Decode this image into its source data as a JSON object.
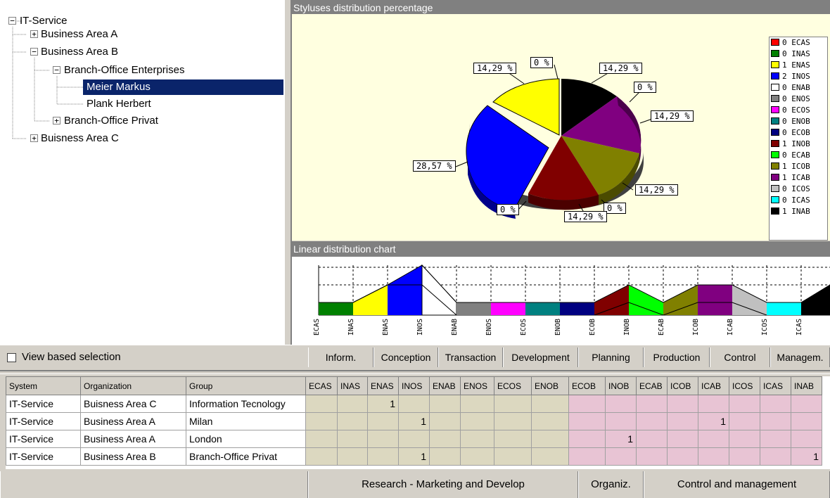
{
  "tree": {
    "root": "IT-Service",
    "area_a": "Business Area A",
    "area_b": "Business Area B",
    "branch_ent": "Branch-Office Enterprises",
    "meier": "Meier Markus",
    "plank": "Plank Herbert",
    "branch_priv": "Branch-Office Privat",
    "area_c": "Buisness Area C"
  },
  "pie": {
    "title": "Styluses distribution percentage",
    "labels": {
      "l1": "14,29 %",
      "l2": "0 %",
      "l3": "14,29 %",
      "l4": "0 %",
      "l5": "14,29 %",
      "l6": "28,57 %",
      "l7": "14,29 %",
      "l8": "0 %",
      "l9": "0 %",
      "l10": "14,29 %"
    },
    "legend": [
      {
        "label": "0 ECAS",
        "color": "#ff0000"
      },
      {
        "label": "0 INAS",
        "color": "#008000"
      },
      {
        "label": "1 ENAS",
        "color": "#ffff00"
      },
      {
        "label": "2 INOS",
        "color": "#0000ff"
      },
      {
        "label": "0 ENAB",
        "color": "#ffffff"
      },
      {
        "label": "0 ENOS",
        "color": "#808080"
      },
      {
        "label": "0 ECOS",
        "color": "#ff00ff"
      },
      {
        "label": "0 ENOB",
        "color": "#008080"
      },
      {
        "label": "0 ECOB",
        "color": "#000080"
      },
      {
        "label": "1 INOB",
        "color": "#800000"
      },
      {
        "label": "0 ECAB",
        "color": "#00ff00"
      },
      {
        "label": "1 ICOB",
        "color": "#808000"
      },
      {
        "label": "1 ICAB",
        "color": "#800080"
      },
      {
        "label": "0 ICOS",
        "color": "#c0c0c0"
      },
      {
        "label": "0 ICAS",
        "color": "#00ffff"
      },
      {
        "label": "1 INAB",
        "color": "#000000"
      }
    ]
  },
  "chart_data": {
    "type": "pie",
    "title": "Styluses distribution percentage",
    "categories": [
      "ECAS",
      "INAS",
      "ENAS",
      "INOS",
      "ENAB",
      "ENOS",
      "ECOS",
      "ENOB",
      "ECOB",
      "INOB",
      "ECAB",
      "ICOB",
      "ICAB",
      "ICOS",
      "ICAS",
      "INAB"
    ],
    "values": [
      0,
      0,
      1,
      2,
      0,
      0,
      0,
      0,
      0,
      1,
      0,
      1,
      1,
      0,
      0,
      1
    ],
    "percent_labels": [
      "14,29 %",
      "28,57 %",
      "14,29 %",
      "14,29 %",
      "14,29 %",
      "14,29 %"
    ],
    "legend_position": "right"
  },
  "linear": {
    "title": "Linear distribution chart",
    "ticks": [
      "ECAS",
      "INAS",
      "ENAS",
      "INOS",
      "ENAB",
      "ENOS",
      "ECOS",
      "ENOB",
      "ECOB",
      "INOB",
      "ECAB",
      "ICOB",
      "ICAB",
      "ICOS",
      "ICAS"
    ]
  },
  "categories": {
    "view_based": "View based selection",
    "inform": "Inform.",
    "conception": "Conception",
    "transaction": "Transaction",
    "development": "Development",
    "planning": "Planning",
    "production": "Production",
    "control": "Control",
    "managem": "Managem."
  },
  "grid": {
    "headers": [
      "System",
      "Organization",
      "Group",
      "ECAS",
      "INAS",
      "ENAS",
      "INOS",
      "ENAB",
      "ENOS",
      "ECOS",
      "ENOB",
      "ECOB",
      "INOB",
      "ECAB",
      "ICOB",
      "ICAB",
      "ICOS",
      "ICAS",
      "INAB"
    ],
    "rows": [
      [
        "IT-Service",
        "Buisness Area C",
        "Information Tecnology",
        "",
        "",
        "1",
        "",
        "",
        "",
        "",
        "",
        "",
        "",
        "",
        "",
        "",
        "",
        "",
        ""
      ],
      [
        "IT-Service",
        "Business Area A",
        "Milan",
        "",
        "",
        "",
        "1",
        "",
        "",
        "",
        "",
        "",
        "",
        "",
        "",
        "1",
        "",
        "",
        ""
      ],
      [
        "IT-Service",
        "Business Area A",
        "London",
        "",
        "",
        "",
        "",
        "",
        "",
        "",
        "",
        "",
        "1",
        "",
        "",
        "",
        "",
        "",
        ""
      ],
      [
        "IT-Service",
        "Business Area B",
        "Branch-Office Privat",
        "",
        "",
        "",
        "1",
        "",
        "",
        "",
        "",
        "",
        "",
        "",
        "",
        "",
        "",
        "",
        "1"
      ]
    ]
  },
  "footer": {
    "research": "Research - Marketing and Develop",
    "organiz": "Organiz.",
    "control_mgmt": "Control and management"
  }
}
